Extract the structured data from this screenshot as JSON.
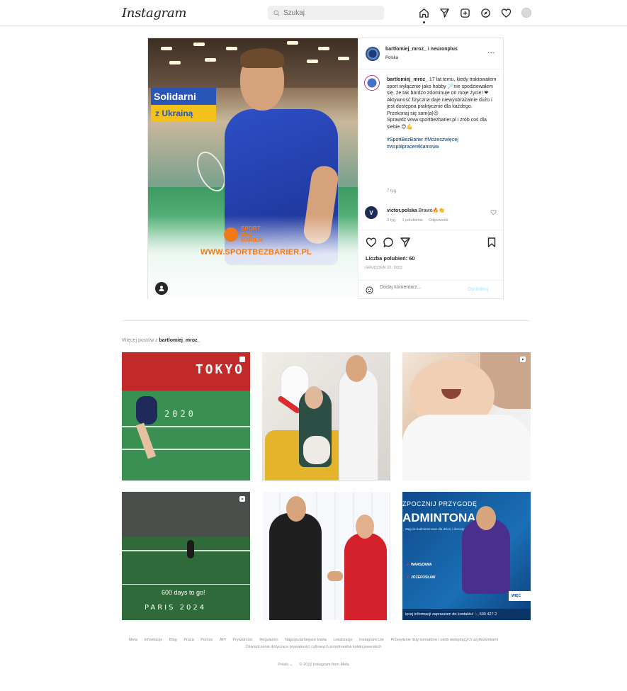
{
  "header": {
    "logo": "Instagram",
    "search_placeholder": "Szukaj"
  },
  "post": {
    "photo": {
      "banner_line1": "Solidarni",
      "banner_line2": "z Ukrainą",
      "logo_text_line1": "SPORT",
      "logo_text_line2": "BEZ",
      "logo_text_line3": "BARIER",
      "url": "WWW.SPORTBEZBARIER.PL"
    },
    "author": "bartlomiej_mroz_ i neuronplus",
    "location": "Polska",
    "more": "...",
    "caption": {
      "username": "bartlomiej_mroz_",
      "line1": "17 lat temu, kiedy traktowałem sport wyłącznie jako hobby 🏸nie spodziewałem się, że tak bardzo zdominuje on moje życie! ❤",
      "line2": "Aktywność fizyczna daje niewyobrażalnie dużo i jest dostępna praktycznie dla każdego.",
      "line3": "Przekonaj się sam(a)😉",
      "line4": "Sprawdź www.sportbezbarier.pl i zrób coś dla siebie 😊💪",
      "tags": "#SportBezBarier #Możeszwięcej #współpracereklamowa",
      "time": "7 tyg."
    },
    "comment": {
      "avatar_letter": "V",
      "username": "victor.polska",
      "text": "Brawo🔥👏",
      "time": "3 tyg.",
      "likes": "1 polubienie",
      "reply": "Odpowiedz"
    },
    "likes": "Liczba polubień: 60",
    "date": "GRUDZIEŃ 22, 2022",
    "comment_placeholder": "Dodaj komentarz...",
    "publish": "Opublikuj"
  },
  "more_posts": {
    "prefix": "Więcej postów z",
    "username": "bartlomiej_mroz_"
  },
  "tiles": {
    "t1": {
      "tokyo": "TOKYO",
      "year": "2020"
    },
    "t4": {
      "days": "600 days to go!",
      "paris": "PARIS 2024"
    },
    "t6": {
      "line1": "ZPOCZNIJ PRZYGODĘ",
      "line2": "ADMINTONA!",
      "sub": "Zajęcia badmintonowe dla dzieci i dorosłych",
      "city1": "WARSZAWA",
      "city2": "JÓZEFOSŁAW",
      "cta": "WIĘC",
      "footer": "ięcej informacji zapraszam do kontaktu! 📞530 427 2"
    }
  },
  "footer": {
    "links": [
      "Meta",
      "Informacje",
      "Blog",
      "Praca",
      "Pomoc",
      "API",
      "Prywatność",
      "Regulamin",
      "Najpopularniejsze konta",
      "Lokalizacje",
      "Instagram Lite",
      "Przesyłanie listy kontaktów i osób niebędących użytkownikami"
    ],
    "links_row2": "Oświadczenie dotyczące prywatności cyfrowych przedmiotów kolekcjonerskich",
    "language": "Polski ⌄",
    "copyright": "© 2022 Instagram from Meta"
  }
}
